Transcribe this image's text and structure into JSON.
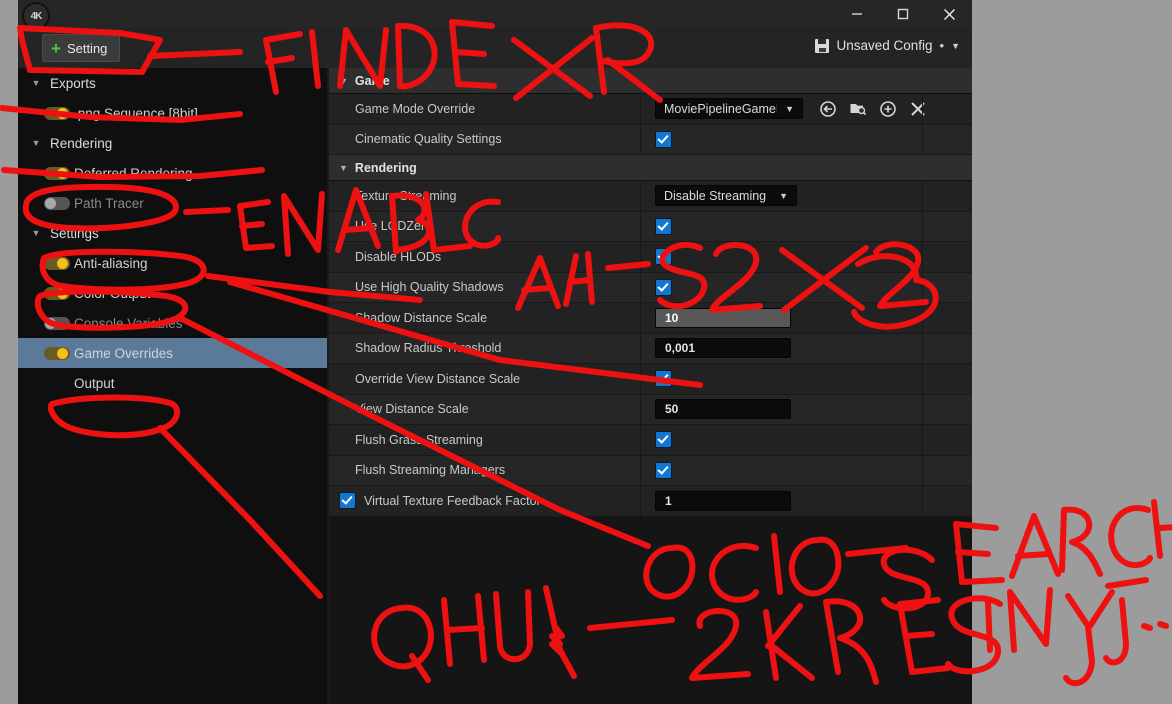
{
  "window": {
    "logo_text": "4K",
    "minimize_label": "—",
    "maximize_label": "❐",
    "close_label": "✕"
  },
  "toolbar": {
    "setting_label": "Setting",
    "plus_icon": "plus-icon",
    "config_label": "Unsaved Config",
    "config_dot": "•",
    "config_caret": "▼",
    "save_icon": "floppy-disk-icon"
  },
  "sidebar": {
    "items": [
      {
        "label": "Exports",
        "type": "group",
        "expander": "▼",
        "toggle": null,
        "dim": false
      },
      {
        "label": ".png Sequence [8bit]",
        "type": "item",
        "expander": "",
        "toggle": "on",
        "dim": false
      },
      {
        "label": "Rendering",
        "type": "group",
        "expander": "▼",
        "toggle": null,
        "dim": false
      },
      {
        "label": "Deferred Rendering",
        "type": "item",
        "expander": "",
        "toggle": "on",
        "dim": false
      },
      {
        "label": "Path Tracer",
        "type": "item",
        "expander": "",
        "toggle": "off",
        "dim": true
      },
      {
        "label": "Settings",
        "type": "group",
        "expander": "▼",
        "toggle": null,
        "dim": false
      },
      {
        "label": "Anti-aliasing",
        "type": "item",
        "expander": "",
        "toggle": "on",
        "dim": false
      },
      {
        "label": "Color Output",
        "type": "item",
        "expander": "",
        "toggle": "on",
        "dim": false
      },
      {
        "label": "Console Variables",
        "type": "item",
        "expander": "",
        "toggle": "off",
        "dim": true
      },
      {
        "label": "Game Overrides",
        "type": "item",
        "expander": "",
        "toggle": "on",
        "dim": false,
        "selected": true
      },
      {
        "label": "Output",
        "type": "item",
        "expander": "",
        "toggle": null,
        "dim": false
      }
    ]
  },
  "details": {
    "sections": [
      {
        "title": "Game",
        "expander": "▼",
        "rows": [
          {
            "name": "Game Mode Override",
            "control": "combo",
            "value": "MoviePipelineGameM",
            "caret": "▼",
            "icons": [
              "browse-to-asset-icon",
              "find-in-content-browser-icon",
              "new-asset-icon",
              "clear-asset-icon"
            ]
          },
          {
            "name": "Cinematic Quality Settings",
            "control": "checkbox",
            "value": true
          }
        ]
      },
      {
        "title": "Rendering",
        "expander": "▼",
        "rows": [
          {
            "name": "Texture Streaming",
            "control": "combo",
            "value": "Disable Streaming",
            "caret": "▼"
          },
          {
            "name": "Use LODZero",
            "control": "checkbox",
            "value": true
          },
          {
            "name": "Disable HLODs",
            "control": "checkbox",
            "value": true
          },
          {
            "name": "Use High Quality Shadows",
            "control": "checkbox",
            "value": true
          },
          {
            "name": "Shadow Distance Scale",
            "control": "number",
            "value": "10",
            "highlight": true
          },
          {
            "name": "Shadow Radius Threshold",
            "control": "number",
            "value": "0,001"
          },
          {
            "name": "Override View Distance Scale",
            "control": "checkbox",
            "value": true
          },
          {
            "name": "View Distance Scale",
            "control": "number",
            "value": "50"
          },
          {
            "name": "Flush Grass Streaming",
            "control": "checkbox",
            "value": true
          },
          {
            "name": "Flush Streaming Managers",
            "control": "checkbox",
            "value": true
          },
          {
            "name": "Virtual Texture Feedback Factor",
            "control": "number",
            "value": "1",
            "leading_checkbox": true
          }
        ]
      }
    ]
  },
  "annotations": {
    "ink_color": "#ee1111",
    "notes": [
      {
        "id": "findexr",
        "text": "FINDEXR"
      },
      {
        "id": "enable",
        "text": "ENABLE"
      },
      {
        "id": "aa",
        "text": "AA - 32X32"
      },
      {
        "id": "ocio",
        "text": "OCIO -SEARCH"
      },
      {
        "id": "inyj",
        "text": "IN YJ..."
      },
      {
        "id": "qhui",
        "text": "QHUI _ 2KRES"
      }
    ]
  }
}
